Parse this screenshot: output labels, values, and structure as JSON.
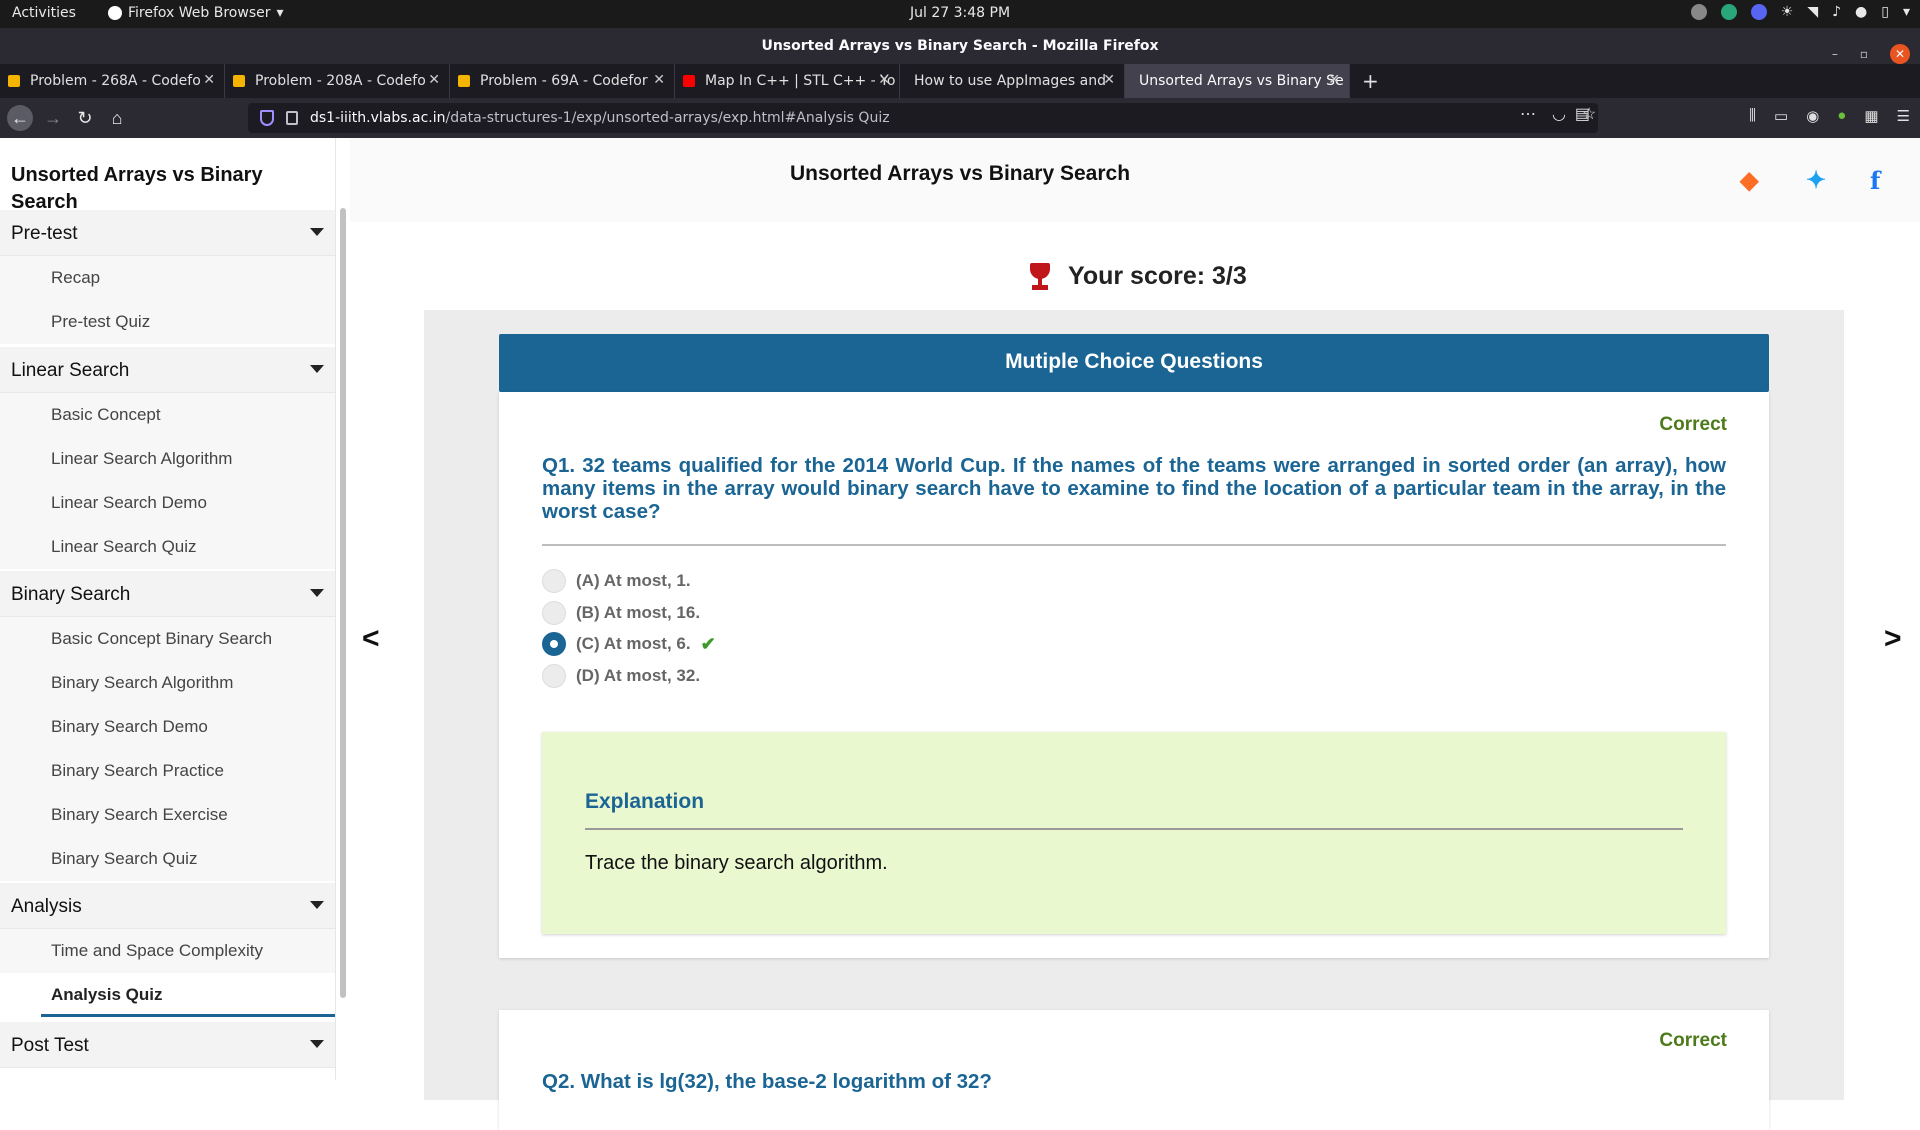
{
  "system": {
    "activities": "Activities",
    "app_menu": "Firefox Web Browser",
    "clock": "Jul 27  3:48 PM"
  },
  "window": {
    "title": "Unsorted Arrays vs Binary Search - Mozilla Firefox"
  },
  "tabs": [
    {
      "label": "Problem - 268A - Codefo",
      "favicon_color": "#f4b400"
    },
    {
      "label": "Problem - 208A - Codefo",
      "favicon_color": "#f4b400"
    },
    {
      "label": "Problem - 69A - Codefor",
      "favicon_color": "#f4b400"
    },
    {
      "label": "Map In C++ | STL C++ - Yo",
      "favicon_color": "#ff0000"
    },
    {
      "label": "How to use AppImages and",
      "favicon_color": ""
    },
    {
      "label": "Unsorted Arrays vs Binary Se",
      "favicon_color": ""
    }
  ],
  "url": {
    "host": "ds1-iiith.vlabs.ac.in",
    "path": "/data-structures-1/exp/unsorted-arrays/exp.html#Analysis Quiz"
  },
  "sidebar": {
    "title": "Unsorted Arrays vs Binary Search",
    "sections": [
      {
        "label": "Pre-test",
        "items": [
          "Recap",
          "Pre-test Quiz"
        ]
      },
      {
        "label": "Linear Search",
        "items": [
          "Basic Concept",
          "Linear Search Algorithm",
          "Linear Search Demo",
          "Linear Search Quiz"
        ]
      },
      {
        "label": "Binary Search",
        "items": [
          "Basic Concept Binary Search",
          "Binary Search Algorithm",
          "Binary Search Demo",
          "Binary Search Practice",
          "Binary Search Exercise",
          "Binary Search Quiz"
        ]
      },
      {
        "label": "Analysis",
        "items": [
          "Time and Space Complexity",
          "Analysis Quiz"
        ]
      },
      {
        "label": "Post Test",
        "items": []
      }
    ],
    "active_item": "Analysis Quiz"
  },
  "main": {
    "page_title": "Unsorted Arrays vs Binary Search",
    "score": "Your score: 3/3",
    "mcq_header": "Mutiple Choice Questions",
    "q1": {
      "status": "Correct",
      "text": "Q1. 32 teams qualified for the 2014 World Cup. If the names of the teams were arranged in sorted order (an array), how many items in the array would binary search have to examine to find the location of a particular team in the array, in the worst case?",
      "options": [
        "(A) At most, 1.",
        "(B) At most, 16.",
        "(C) At most, 6.",
        "(D) At most, 32."
      ],
      "selected": "(C) At most, 6.",
      "explanation_title": "Explanation",
      "explanation": "Trace the binary search algorithm."
    },
    "q2": {
      "status": "Correct",
      "text_partial": "Q2. What is lg(32), the base-2 logarithm of 32?"
    }
  },
  "colors": {
    "accent": "#1b6595",
    "correct": "#4d7a1a",
    "explanation_bg": "#eaf8d0"
  }
}
